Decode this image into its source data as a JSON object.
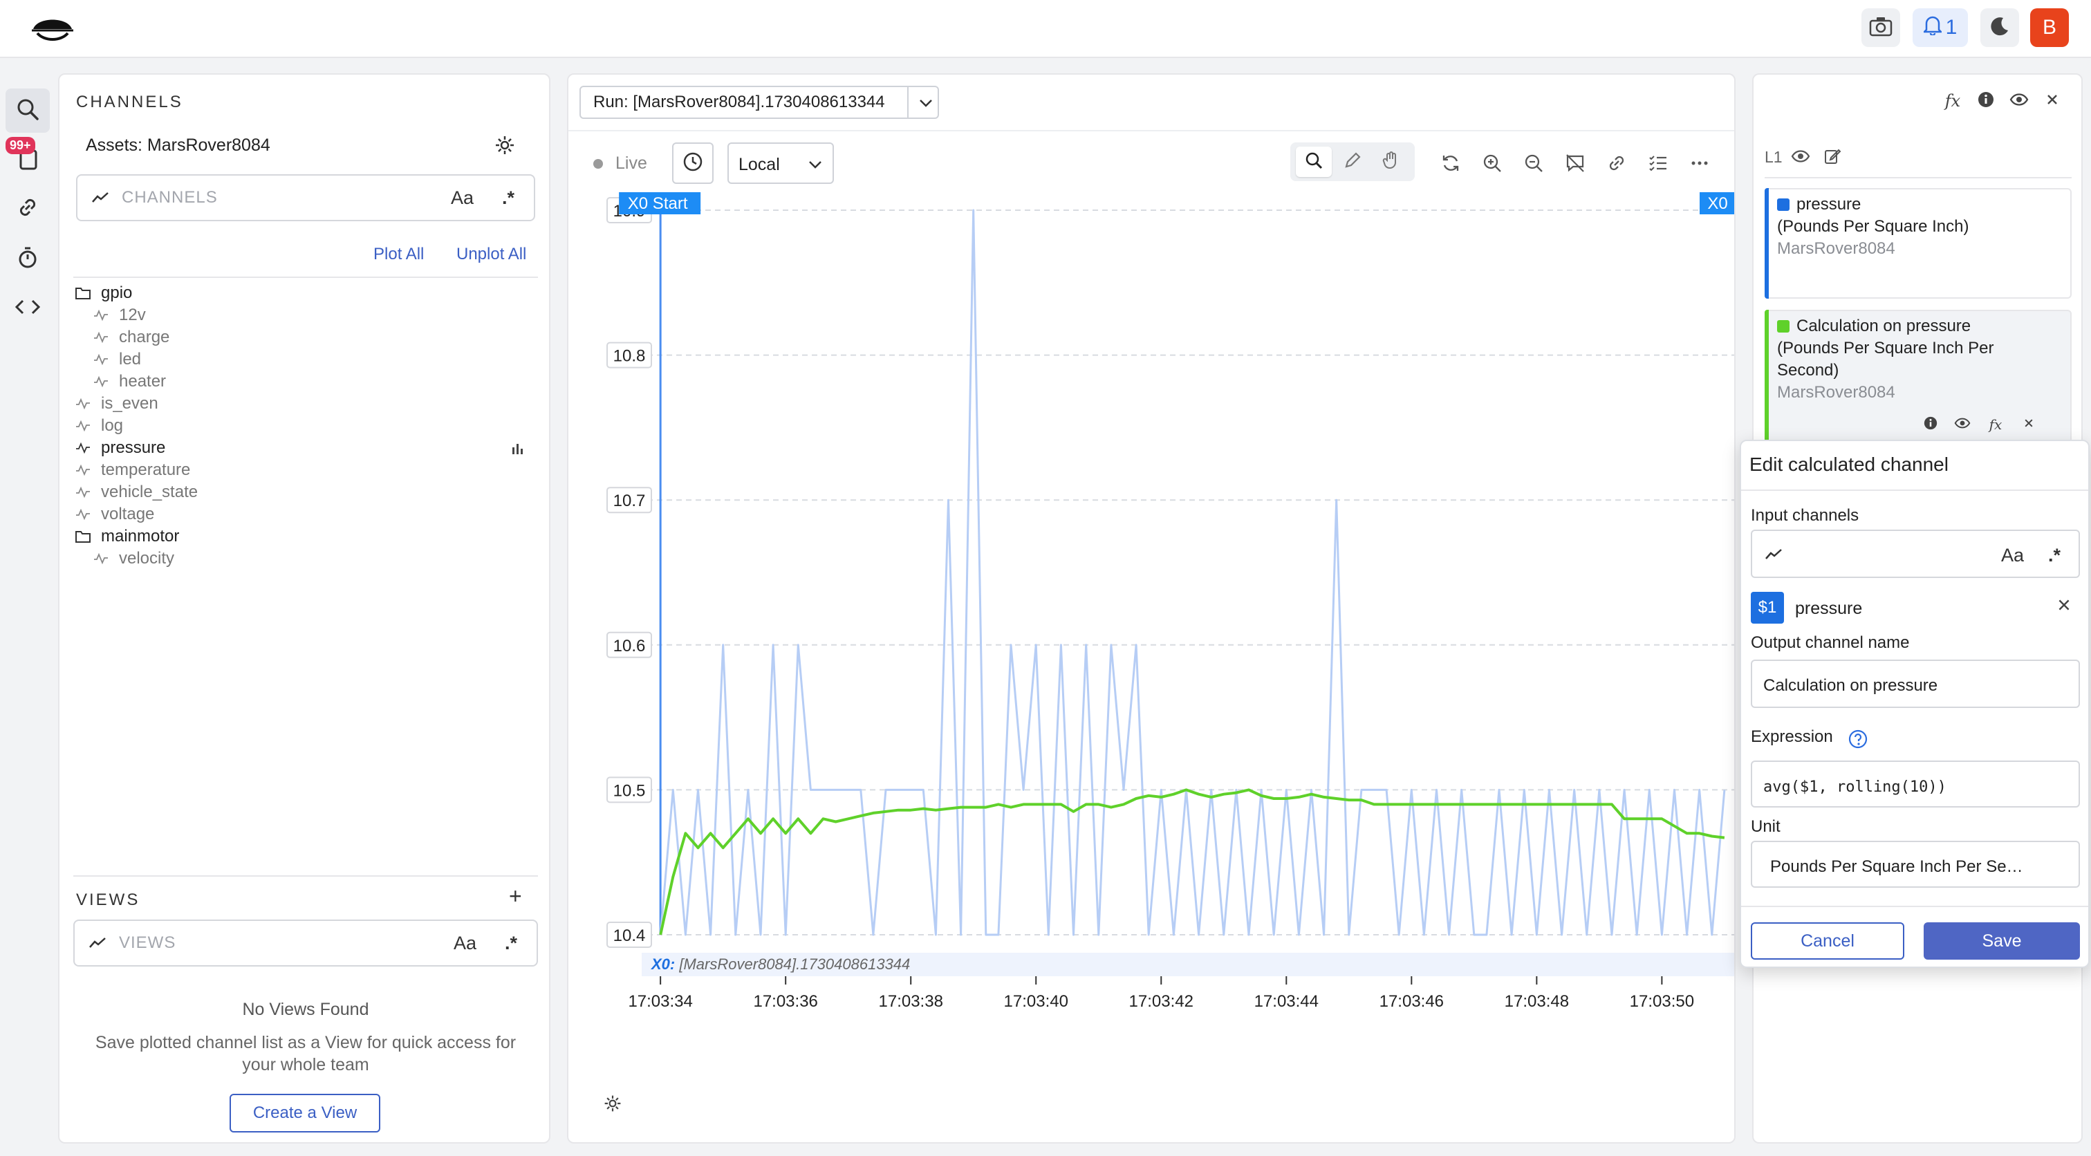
{
  "topbar": {
    "notification_count": "1",
    "avatar_letter": "B"
  },
  "rail": {
    "badge": "99+"
  },
  "channels_panel": {
    "title": "CHANNELS",
    "assets_label": "Assets: MarsRover8084",
    "search_placeholder": "CHANNELS",
    "case_toggle": "Aa",
    "regex_toggle": ".*",
    "plot_all": "Plot All",
    "unplot_all": "Unplot All",
    "tree": [
      {
        "label": "gpio",
        "type": "folder",
        "depth": 0
      },
      {
        "label": "12v",
        "type": "leaf",
        "depth": 1
      },
      {
        "label": "charge",
        "type": "leaf",
        "depth": 1
      },
      {
        "label": "led",
        "type": "leaf",
        "depth": 1
      },
      {
        "label": "heater",
        "type": "leaf",
        "depth": 1
      },
      {
        "label": "is_even",
        "type": "leaf",
        "depth": 0
      },
      {
        "label": "log",
        "type": "leaf",
        "depth": 0
      },
      {
        "label": "pressure",
        "type": "leaf",
        "depth": 0,
        "plotted": true
      },
      {
        "label": "temperature",
        "type": "leaf",
        "depth": 0
      },
      {
        "label": "vehicle_state",
        "type": "leaf",
        "depth": 0
      },
      {
        "label": "voltage",
        "type": "leaf",
        "depth": 0
      },
      {
        "label": "mainmotor",
        "type": "folder",
        "depth": 0
      },
      {
        "label": "velocity",
        "type": "leaf",
        "depth": 1
      }
    ]
  },
  "views_panel": {
    "title": "VIEWS",
    "add": "+",
    "search_placeholder": "VIEWS",
    "case_toggle": "Aa",
    "regex_toggle": ".*",
    "empty_title": "No Views Found",
    "empty_desc": "Save plotted channel list as a View for quick access for your whole team",
    "create_button": "Create a View"
  },
  "plot_panel": {
    "run_label": "Run: [MarsRover8084].1730408613344",
    "live_label": "Live",
    "timezone": "Local",
    "cursor_start_label": "X0 Start",
    "cursor_end_label": "X0",
    "x_axis_caption_prefix": "X0:",
    "x_axis_caption": "[MarsRover8084].1730408613344"
  },
  "chart_data": {
    "type": "line",
    "ylim": [
      10.4,
      10.9
    ],
    "y_ticks": [
      "10.9",
      "10.8",
      "10.7",
      "10.6",
      "10.5",
      "10.4"
    ],
    "x_ticks": [
      "17:03:34",
      "17:03:36",
      "17:03:38",
      "17:03:40",
      "17:03:42",
      "17:03:44",
      "17:03:46",
      "17:03:48",
      "17:03:50"
    ],
    "xlim": [
      -0.3,
      17.2
    ],
    "series": [
      {
        "name": "pressure",
        "color": "#b6cdf5",
        "x": [
          0.0,
          0.2,
          0.4,
          0.6,
          0.8,
          1.0,
          1.2,
          1.4,
          1.6,
          1.8,
          2.0,
          2.2,
          2.4,
          2.6,
          2.8,
          3.0,
          3.2,
          3.4,
          3.6,
          3.8,
          4.0,
          4.2,
          4.4,
          4.6,
          4.8,
          5.0,
          5.2,
          5.4,
          5.6,
          5.8,
          6.0,
          6.2,
          6.4,
          6.6,
          6.8,
          7.0,
          7.2,
          7.4,
          7.6,
          7.8,
          8.0,
          8.2,
          8.4,
          8.6,
          8.8,
          9.0,
          9.2,
          9.4,
          9.6,
          9.8,
          10.0,
          10.2,
          10.4,
          10.6,
          10.8,
          11.0,
          11.2,
          11.4,
          11.6,
          11.8,
          12.0,
          12.2,
          12.4,
          12.6,
          12.8,
          13.0,
          13.2,
          13.4,
          13.6,
          13.8,
          14.0,
          14.2,
          14.4,
          14.6,
          14.8,
          15.0,
          15.2,
          15.4,
          15.6,
          15.8,
          16.0,
          16.2,
          16.4,
          16.6,
          16.8,
          17.0
        ],
        "y": [
          10.4,
          10.5,
          10.4,
          10.5,
          10.4,
          10.6,
          10.4,
          10.5,
          10.4,
          10.6,
          10.4,
          10.6,
          10.5,
          10.5,
          10.5,
          10.5,
          10.5,
          10.4,
          10.5,
          10.5,
          10.5,
          10.5,
          10.4,
          10.7,
          10.4,
          10.9,
          10.4,
          10.4,
          10.6,
          10.5,
          10.6,
          10.4,
          10.6,
          10.4,
          10.6,
          10.4,
          10.6,
          10.5,
          10.6,
          10.4,
          10.5,
          10.4,
          10.5,
          10.4,
          10.5,
          10.4,
          10.5,
          10.4,
          10.5,
          10.4,
          10.5,
          10.4,
          10.5,
          10.4,
          10.7,
          10.4,
          10.5,
          10.5,
          10.5,
          10.4,
          10.5,
          10.4,
          10.5,
          10.4,
          10.5,
          10.4,
          10.4,
          10.5,
          10.4,
          10.5,
          10.4,
          10.5,
          10.4,
          10.5,
          10.4,
          10.5,
          10.4,
          10.5,
          10.4,
          10.5,
          10.4,
          10.5,
          10.4,
          10.5,
          10.4,
          10.5
        ]
      },
      {
        "name": "Calculation on pressure",
        "color": "#5fd12a",
        "x": [
          0.0,
          0.2,
          0.4,
          0.6,
          0.8,
          1.0,
          1.2,
          1.4,
          1.6,
          1.8,
          2.0,
          2.2,
          2.4,
          2.6,
          2.8,
          3.0,
          3.2,
          3.4,
          3.6,
          3.8,
          4.0,
          4.2,
          4.4,
          4.6,
          4.8,
          5.0,
          5.2,
          5.4,
          5.6,
          5.8,
          6.0,
          6.2,
          6.4,
          6.6,
          6.8,
          7.0,
          7.2,
          7.4,
          7.6,
          7.8,
          8.0,
          8.2,
          8.4,
          8.6,
          8.8,
          9.0,
          9.2,
          9.4,
          9.6,
          9.8,
          10.0,
          10.2,
          10.4,
          10.6,
          10.8,
          11.0,
          11.2,
          11.4,
          11.6,
          11.8,
          12.0,
          12.2,
          12.4,
          12.6,
          12.8,
          13.0,
          13.2,
          13.4,
          13.6,
          13.8,
          14.0,
          14.2,
          14.4,
          14.6,
          14.8,
          15.0,
          15.2,
          15.4,
          15.6,
          15.8,
          16.0,
          16.2,
          16.4,
          16.6,
          16.8,
          17.0
        ],
        "y": [
          10.4,
          10.44,
          10.47,
          10.46,
          10.47,
          10.46,
          10.47,
          10.48,
          10.47,
          10.48,
          10.47,
          10.48,
          10.47,
          10.48,
          10.478,
          10.48,
          10.482,
          10.484,
          10.485,
          10.486,
          10.486,
          10.487,
          10.486,
          10.487,
          10.488,
          10.488,
          10.488,
          10.49,
          10.488,
          10.49,
          10.49,
          10.49,
          10.49,
          10.485,
          10.49,
          10.49,
          10.488,
          10.49,
          10.494,
          10.496,
          10.495,
          10.497,
          10.5,
          10.497,
          10.495,
          10.497,
          10.498,
          10.5,
          10.496,
          10.494,
          10.494,
          10.495,
          10.497,
          10.495,
          10.494,
          10.493,
          10.493,
          10.49,
          10.49,
          10.49,
          10.49,
          10.49,
          10.49,
          10.49,
          10.49,
          10.49,
          10.49,
          10.49,
          10.49,
          10.49,
          10.49,
          10.49,
          10.49,
          10.49,
          10.49,
          10.49,
          10.49,
          10.48,
          10.48,
          10.48,
          10.48,
          10.475,
          10.47,
          10.47,
          10.468,
          10.467
        ]
      }
    ],
    "grid": true
  },
  "legend_panel": {
    "layer": "L1",
    "entries": [
      {
        "name": "pressure",
        "unit": "(Pounds Per Square Inch)",
        "asset": "MarsRover8084",
        "color": "#1d6fe0"
      },
      {
        "name": "Calculation on pressure",
        "unit_line1": "(Pounds Per Square Inch Per",
        "unit_line2": "Second)",
        "asset": "MarsRover8084",
        "color": "#5fd12a"
      }
    ]
  },
  "dialog": {
    "title": "Edit calculated channel",
    "input_channels_label": "Input channels",
    "case_toggle": "Aa",
    "regex_toggle": ".*",
    "chip_var": "$1",
    "chip_channel": "pressure",
    "output_label": "Output channel name",
    "output_value": "Calculation on pressure",
    "expression_label": "Expression",
    "expression_value": "avg($1, rolling(10))",
    "unit_label": "Unit",
    "unit_value": "Pounds Per Square Inch Per Se…",
    "cancel": "Cancel",
    "save": "Save"
  }
}
